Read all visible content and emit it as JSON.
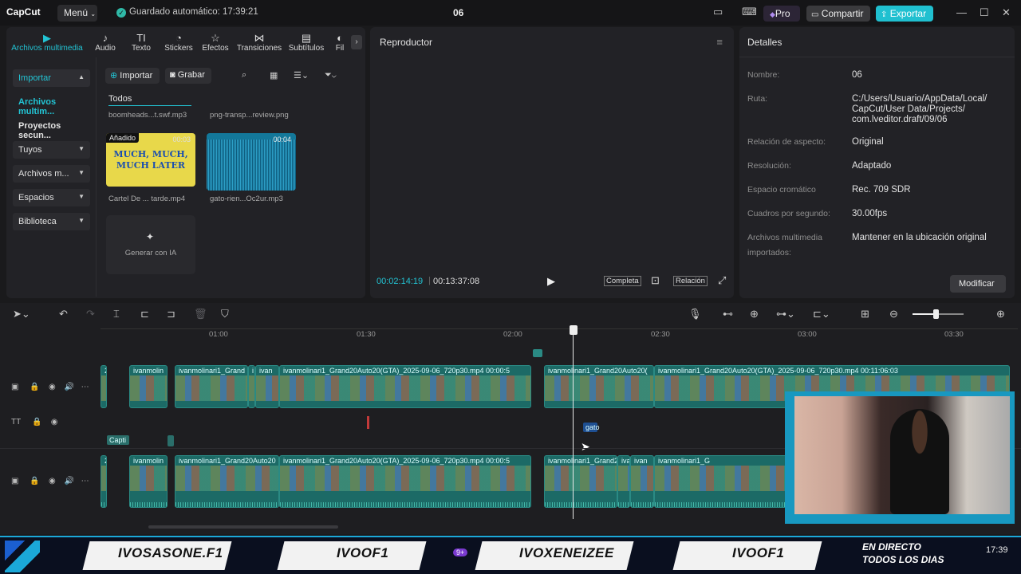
{
  "titlebar": {
    "logo": "CapCut",
    "menu_label": "Menú",
    "autosave": "Guardado automático: 17:39:21",
    "project_name": "06",
    "pro_label": "Pro",
    "share_label": "Compartir",
    "export_label": "Exportar"
  },
  "media": {
    "tabs": [
      {
        "label": "Archivos multimedia",
        "icon": "media-icon"
      },
      {
        "label": "Audio",
        "icon": "audio-icon"
      },
      {
        "label": "Texto",
        "icon": "text-icon"
      },
      {
        "label": "Stickers",
        "icon": "sticker-icon"
      },
      {
        "label": "Efectos",
        "icon": "effects-icon"
      },
      {
        "label": "Transiciones",
        "icon": "transitions-icon"
      },
      {
        "label": "Subtítulos",
        "icon": "subtitles-icon"
      },
      {
        "label": "Fil",
        "icon": "filter-icon"
      }
    ],
    "sidebar": [
      {
        "label": "Importar"
      },
      {
        "label": "Archivos multim..."
      },
      {
        "label": "Proyectos secun..."
      },
      {
        "label": "Tuyos"
      },
      {
        "label": "Archivos m..."
      },
      {
        "label": "Espacios"
      },
      {
        "label": "Biblioteca"
      }
    ],
    "import_btn": "Importar",
    "record_btn": "Grabar",
    "filter_all": "Todos",
    "items": [
      {
        "caption": "boomheads...t.swf.mp3"
      },
      {
        "caption": "png-transp...review.png"
      },
      {
        "caption": "Cartel De ... tarde.mp4",
        "badge": "Añadido",
        "duration": "00:03",
        "thumb_text": "MUCH, MUCH, MUCH LATER"
      },
      {
        "caption": "gato-rien...Oc2ur.mp3",
        "duration": "00:04"
      }
    ],
    "ai_label": "Generar con IA"
  },
  "player": {
    "title": "Reproductor",
    "current_time": "00:02:14:19",
    "total_time": "00:13:37:08",
    "full_label": "Completa",
    "ratio_label": "Relación"
  },
  "details": {
    "title": "Detalles",
    "rows": [
      {
        "key": "Nombre:",
        "value": "06"
      },
      {
        "key": "Ruta:",
        "value": "C:/Users/Usuario/AppData/Local/ CapCut/User Data/Projects/ com.lveditor.draft/09/06"
      },
      {
        "key": "Relación de aspecto:",
        "value": "Original"
      },
      {
        "key": "Resolución:",
        "value": "Adaptado"
      },
      {
        "key": "Espacio cromático",
        "value": "Rec. 709 SDR"
      },
      {
        "key": "Cuadros por segundo:",
        "value": "30.00fps"
      },
      {
        "key": "Archivos multimedia importados:",
        "value": "Mantener en la ubicación original"
      }
    ],
    "modify_btn": "Modificar"
  },
  "timeline": {
    "ruler": [
      "01:00",
      "01:30",
      "02:00",
      "02:30",
      "03:00",
      "03:30"
    ],
    "zoom_level": 0.45,
    "track1": [
      {
        "name": "2"
      },
      {
        "name": "ivanmolin"
      },
      {
        "name": "ivanmolinari1_Grand"
      },
      {
        "name": "i"
      },
      {
        "name": "ivan"
      },
      {
        "name": "ivanmolinari1_Grand20Auto20(GTA)_2025-09-06_720p30.mp4   00:00:5"
      },
      {
        "name": "ivanmolinari1_Grand20Auto20("
      },
      {
        "name": "ivanmolinari1_Grand20Auto20(GTA)_2025-09-06_720p30.mp4   00:11:06:03"
      }
    ],
    "caption_clip": "Capti",
    "audio_clip": "gato",
    "track2": [
      {
        "name": "2"
      },
      {
        "name": "ivanmolin"
      },
      {
        "name": "ivanmolinari1_Grand20Auto20"
      },
      {
        "name": "ivanmolinari1_Grand20Auto20(GTA)_2025-09-06_720p30.mp4   00:00:5"
      },
      {
        "name": "ivanmolinari1_Grand2"
      },
      {
        "name": "iva"
      },
      {
        "name": "ivan"
      },
      {
        "name": "ivanmolinari1_G"
      }
    ]
  },
  "banner": {
    "items": [
      "IVOSASONE.F1",
      "IVOOF1",
      "IVOXENEIZEE",
      "IVOOF1"
    ],
    "live": "EN DIRECTO TODOS LOS DIAS",
    "clock": "17:39",
    "notif": "9+"
  },
  "colors": {
    "accent": "#22c4d4",
    "export": "#20c0d0",
    "clip": "#1c6a66",
    "banner_border": "#1ba8d8"
  }
}
